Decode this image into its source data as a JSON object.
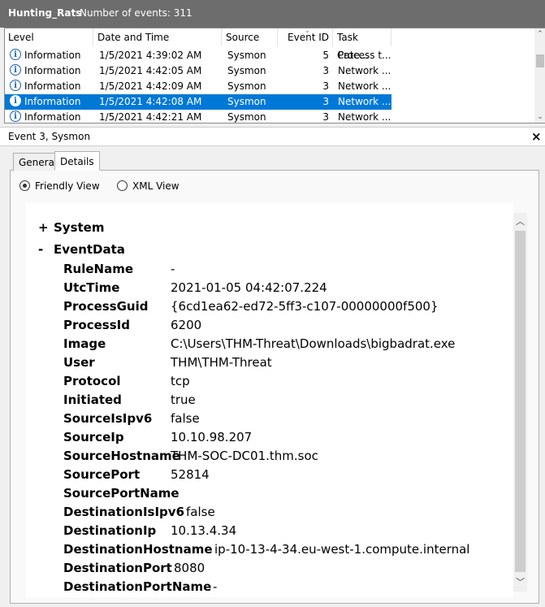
{
  "header": {
    "log_name": "Hunting_Rats",
    "event_count_label": "Number of events: 311"
  },
  "columns": [
    "Level",
    "Date and Time",
    "Source",
    "Event ID",
    "Task Cate..."
  ],
  "events": [
    {
      "level": "Information",
      "datetime": "1/5/2021 4:39:02 AM",
      "source": "Sysmon",
      "event_id": "5",
      "task": "Process t...",
      "selected": false
    },
    {
      "level": "Information",
      "datetime": "1/5/2021 4:42:05 AM",
      "source": "Sysmon",
      "event_id": "3",
      "task": "Network ...",
      "selected": false
    },
    {
      "level": "Information",
      "datetime": "1/5/2021 4:42:09 AM",
      "source": "Sysmon",
      "event_id": "3",
      "task": "Network ...",
      "selected": false
    },
    {
      "level": "Information",
      "datetime": "1/5/2021 4:42:08 AM",
      "source": "Sysmon",
      "event_id": "3",
      "task": "Network ...",
      "selected": true
    },
    {
      "level": "Information",
      "datetime": "1/5/2021 4:42:21 AM",
      "source": "Sysmon",
      "event_id": "3",
      "task": "Network ...",
      "selected": false
    }
  ],
  "detail": {
    "title": "Event 3, Sysmon",
    "close_glyph": "×",
    "tabs": {
      "general": "General",
      "details": "Details"
    },
    "view_options": {
      "friendly": "Friendly View",
      "xml": "XML View",
      "selected": "friendly"
    },
    "tree": {
      "system": {
        "sign": "+",
        "label": "System"
      },
      "event_data": {
        "sign": "-",
        "label": "EventData"
      }
    },
    "fields": [
      {
        "key": "RuleName",
        "value": "-"
      },
      {
        "key": "UtcTime",
        "value": "2021-01-05 04:42:07.224"
      },
      {
        "key": "ProcessGuid",
        "value": "{6cd1ea62-ed72-5ff3-c107-00000000f500}"
      },
      {
        "key": "ProcessId",
        "value": "6200"
      },
      {
        "key": "Image",
        "value": "C:\\Users\\THM-Threat\\Downloads\\bigbadrat.exe"
      },
      {
        "key": "User",
        "value": "THM\\THM-Threat"
      },
      {
        "key": "Protocol",
        "value": "tcp"
      },
      {
        "key": "Initiated",
        "value": "true"
      },
      {
        "key": "SourceIsIpv6",
        "value": "false"
      },
      {
        "key": "SourceIp",
        "value": "10.10.98.207"
      },
      {
        "key": "SourceHostname",
        "value": "THM-SOC-DC01.thm.soc"
      },
      {
        "key": "SourcePort",
        "value": "52814"
      },
      {
        "key": "SourcePortName",
        "value": "-"
      },
      {
        "key": "DestinationIsIpv6",
        "value": "false"
      },
      {
        "key": "DestinationIp",
        "value": "10.13.4.34"
      },
      {
        "key": "DestinationHostname",
        "value": "ip-10-13-4-34.eu-west-1.compute.internal"
      },
      {
        "key": "DestinationPort",
        "value": "8080"
      },
      {
        "key": "DestinationPortName",
        "value": "-"
      }
    ]
  },
  "colors": {
    "header_bg": "#6d6d6d",
    "selection": "#0078d7",
    "info_icon": "#1a5fb4"
  },
  "icons": {
    "level_icon": "information-icon",
    "close": "close-icon"
  }
}
